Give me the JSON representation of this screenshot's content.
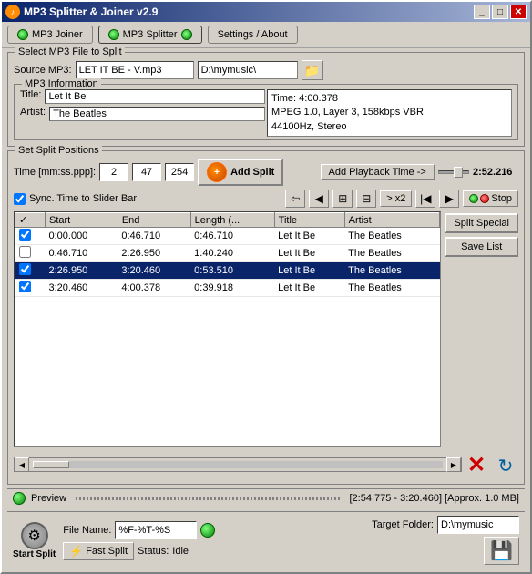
{
  "window": {
    "title": "MP3 Splitter & Joiner v2.9",
    "min_label": "_",
    "max_label": "□",
    "close_label": "✕"
  },
  "toolbar": {
    "joiner_label": "MP3 Joiner",
    "splitter_label": "MP3 Splitter",
    "settings_label": "Settings / About"
  },
  "source": {
    "group_label": "Select MP3 File to Split",
    "source_label": "Source MP3:",
    "file_value": "LET IT BE - V.mp3",
    "path_value": "D:\\mymusic\\",
    "info_group_label": "MP3 Information",
    "title_label": "Title:",
    "title_value": "Let It Be",
    "artist_label": "Artist:",
    "artist_value": "The Beatles",
    "time_info": "Time: 4:00.378",
    "mpeg_info": "MPEG 1.0, Layer 3, 158kbps VBR",
    "hz_info": "44100Hz, Stereo"
  },
  "split": {
    "group_label": "Set Split Positions",
    "time_label": "Time [mm:ss.ppp]:",
    "time_mm": "2",
    "time_ss": "47",
    "time_ppp": "254",
    "add_split_label": "Add Split",
    "playback_btn_label": "Add Playback Time ->",
    "time_display": "2:52.216",
    "sync_label": "Sync. Time to Slider Bar",
    "x2_label": "> x2",
    "stop_label": "Stop",
    "table": {
      "col_check": "✓",
      "col_start": "Start",
      "col_end": "End",
      "col_length": "Length (...",
      "col_title": "Title",
      "col_artist": "Artist",
      "rows": [
        {
          "checked": true,
          "start": "0:00.000",
          "end": "0:46.710",
          "length": "0:46.710",
          "title": "Let It Be",
          "artist": "The Beatles",
          "selected": false
        },
        {
          "checked": false,
          "start": "0:46.710",
          "end": "2:26.950",
          "length": "1:40.240",
          "title": "Let It Be",
          "artist": "The Beatles",
          "selected": false
        },
        {
          "checked": true,
          "start": "2:26.950",
          "end": "3:20.460",
          "length": "0:53.510",
          "title": "Let It Be",
          "artist": "The Beatles",
          "selected": true
        },
        {
          "checked": true,
          "start": "3:20.460",
          "end": "4:00.378",
          "length": "0:39.918",
          "title": "Let It Be",
          "artist": "The Beatles",
          "selected": false
        }
      ]
    },
    "split_special_label": "Split Special",
    "save_list_label": "Save List"
  },
  "preview": {
    "label": "Preview",
    "time_range": "[2:54.775 - 3:20.460] [Approx. 1.0 MB]"
  },
  "bottom": {
    "start_split_label": "Start Split",
    "file_name_label": "File Name:",
    "file_name_value": "%F-%T-%S",
    "target_folder_label": "Target Folder:",
    "target_folder_value": "D:\\mymusic",
    "fast_split_label": "Fast Split",
    "status_label": "Status:",
    "status_value": "Idle"
  },
  "icons": {
    "folder": "🗁",
    "gear": "⚙",
    "lightning": "⚡",
    "back": "◀",
    "forward": "▶",
    "rewind": "◀◀",
    "skip": "▶▶",
    "prev": "⇦",
    "next": "⇨",
    "copy1": "⧉",
    "copy2": "⊡"
  }
}
